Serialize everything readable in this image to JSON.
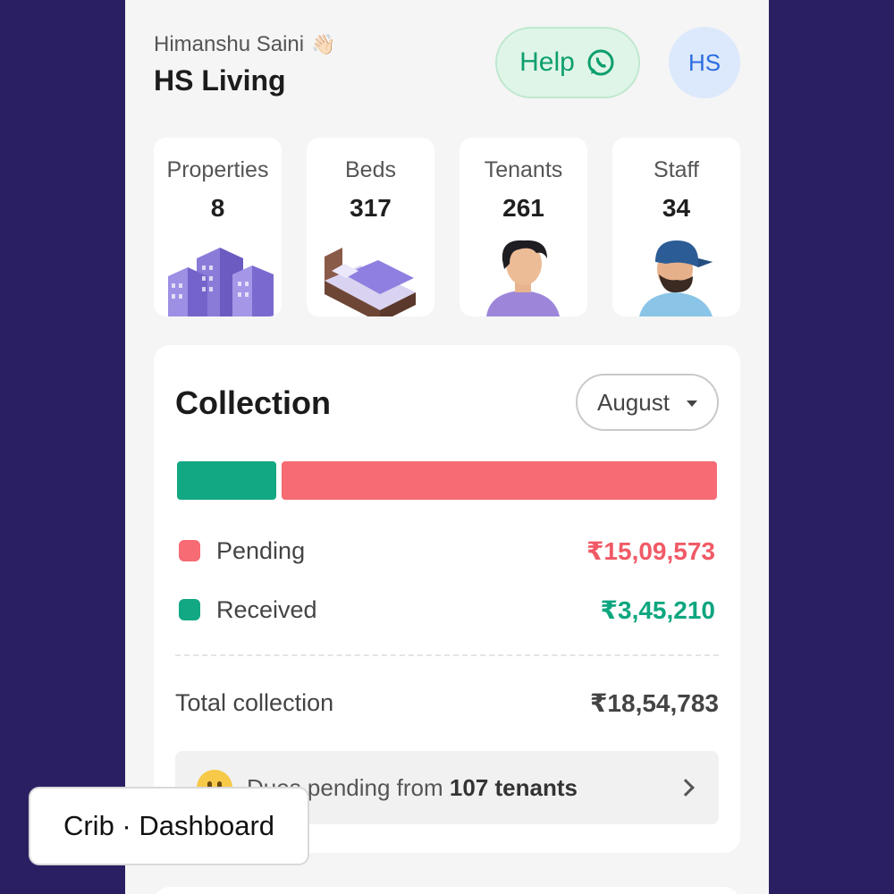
{
  "header": {
    "user_name": "Himanshu Saini",
    "wave_emoji": "👋🏻",
    "org_name": "HS Living",
    "help_label": "Help",
    "help_icon": "whatsapp-icon",
    "avatar_initials": "HS"
  },
  "stats": [
    {
      "label": "Properties",
      "value": "8",
      "icon": "buildings-icon"
    },
    {
      "label": "Beds",
      "value": "317",
      "icon": "bed-icon"
    },
    {
      "label": "Tenants",
      "value": "261",
      "icon": "tenant-icon"
    },
    {
      "label": "Staff",
      "value": "34",
      "icon": "staff-icon"
    }
  ],
  "collection": {
    "title": "Collection",
    "month": "August",
    "bar": {
      "received_fraction": 0.186,
      "pending_fraction": 0.814
    },
    "colors": {
      "received": "#12a883",
      "pending": "#f66b74"
    },
    "pending_label": "Pending",
    "pending_amount": "₹15,09,573",
    "received_label": "Received",
    "received_amount": "₹3,45,210",
    "total_label": "Total collection",
    "total_amount": "₹18,54,783",
    "dues_prefix": "Dues pending from",
    "dues_bold": "107 tenants"
  },
  "badge": {
    "label": "Crib · Dashboard"
  }
}
